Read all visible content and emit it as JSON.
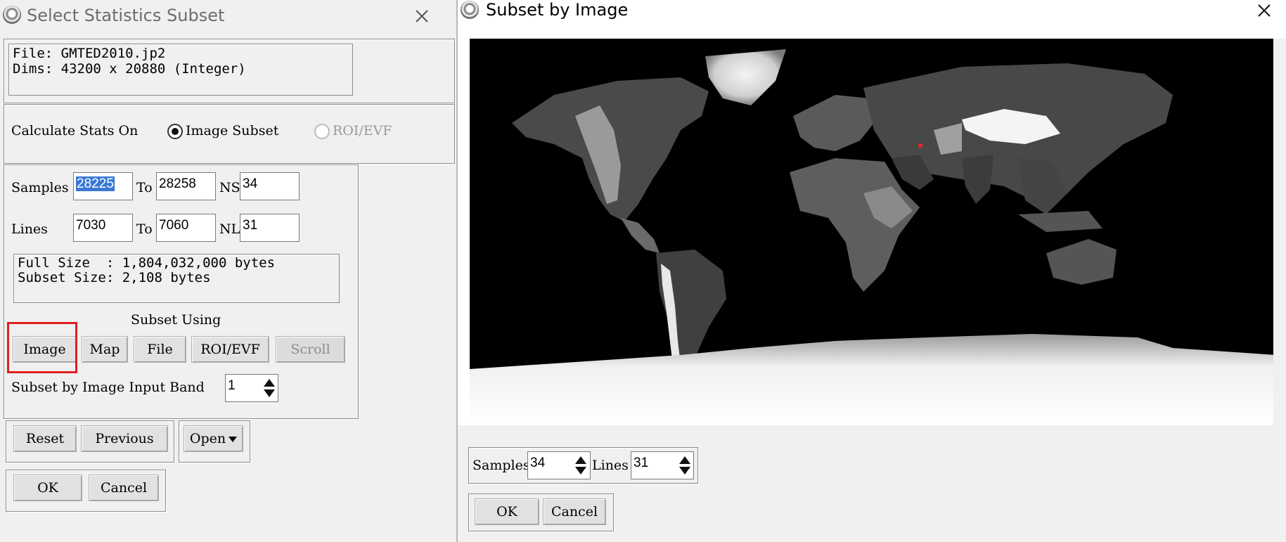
{
  "dialog1": {
    "title": "Select Statistics Subset",
    "file_line": "File: GMTED2010.jp2",
    "dims_line": "Dims: 43200 x 20880 (Integer)",
    "calc_label": "Calculate Stats On",
    "radio_image_subset": "Image Subset",
    "radio_roi_evf": "ROI/EVF",
    "samples_label": "Samples",
    "samples_from": "28225",
    "to_label": "To",
    "samples_to": "28258",
    "ns_label": "NS",
    "ns_value": "34",
    "lines_label": "Lines",
    "lines_from": "7030",
    "lines_to": "7060",
    "nl_label": "NL",
    "nl_value": "31",
    "full_size": "Full Size  : 1,804,032,000 bytes",
    "subset_size": "Subset Size: 2,108 bytes",
    "subset_using_label": "Subset Using",
    "buttons": {
      "image": "Image",
      "map": "Map",
      "file": "File",
      "roi_evf": "ROI/EVF",
      "scroll": "Scroll"
    },
    "input_band_label": "Subset by Image Input Band",
    "input_band_value": "1",
    "reset": "Reset",
    "previous": "Previous",
    "open": "Open",
    "ok": "OK",
    "cancel": "Cancel"
  },
  "dialog2": {
    "title": "Subset by Image",
    "samples_label": "Samples",
    "samples_value": "34",
    "lines_label": "Lines",
    "lines_value": "31",
    "ok": "OK",
    "cancel": "Cancel"
  },
  "icons": [
    "app-icon",
    "close-icon",
    "spinner-icon",
    "dropdown-arrow-icon"
  ],
  "colors": {
    "selection": "#3a78d4",
    "highlight": "#e02020",
    "marker": "#ff2020"
  }
}
